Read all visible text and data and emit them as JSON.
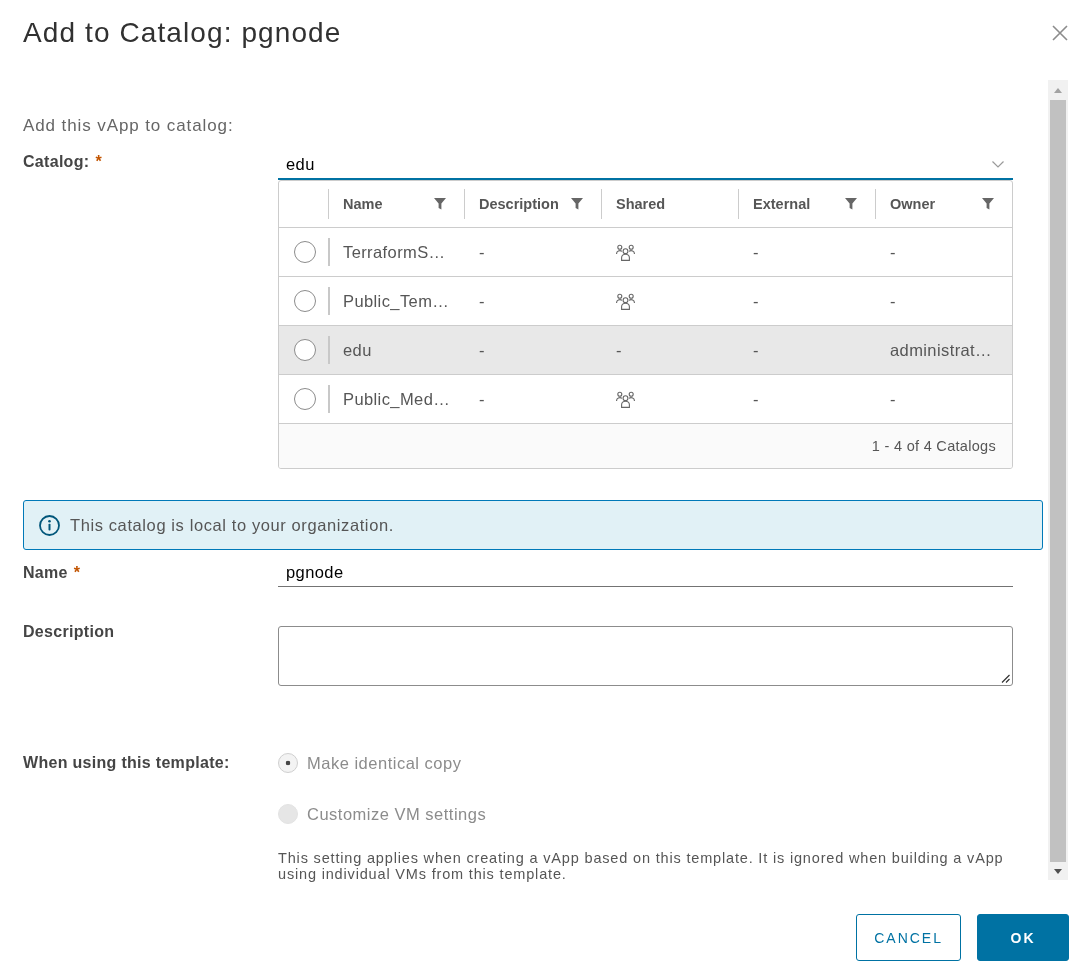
{
  "dialog": {
    "title": "Add to Catalog: pgnode"
  },
  "intro": "Add this vApp to catalog:",
  "catalog": {
    "label": "Catalog:",
    "required_mark": "*",
    "value": "edu",
    "table": {
      "columns": [
        {
          "label": "Name",
          "filter": true
        },
        {
          "label": "Description",
          "filter": true
        },
        {
          "label": "Shared",
          "filter": false
        },
        {
          "label": "External",
          "filter": true
        },
        {
          "label": "Owner",
          "filter": true
        }
      ],
      "rows": [
        {
          "selected": false,
          "highlighted": false,
          "cells": [
            {
              "kind": "text",
              "text": "TerraformS…"
            },
            {
              "kind": "text",
              "text": "-"
            },
            {
              "kind": "icon"
            },
            {
              "kind": "text",
              "text": "-"
            },
            {
              "kind": "text",
              "text": "-"
            }
          ]
        },
        {
          "selected": false,
          "highlighted": false,
          "cells": [
            {
              "kind": "text",
              "text": "Public_Tem…"
            },
            {
              "kind": "text",
              "text": "-"
            },
            {
              "kind": "icon"
            },
            {
              "kind": "text",
              "text": "-"
            },
            {
              "kind": "text",
              "text": "-"
            }
          ]
        },
        {
          "selected": false,
          "highlighted": true,
          "cells": [
            {
              "kind": "text",
              "text": "edu"
            },
            {
              "kind": "text",
              "text": "-"
            },
            {
              "kind": "text",
              "text": "-"
            },
            {
              "kind": "text",
              "text": "-"
            },
            {
              "kind": "text",
              "text": "administrat…"
            }
          ]
        },
        {
          "selected": false,
          "highlighted": false,
          "cells": [
            {
              "kind": "text",
              "text": "Public_Med…"
            },
            {
              "kind": "text",
              "text": "-"
            },
            {
              "kind": "icon"
            },
            {
              "kind": "text",
              "text": "-"
            },
            {
              "kind": "text",
              "text": "-"
            }
          ]
        }
      ],
      "footer": "1 - 4 of 4 Catalogs"
    }
  },
  "alert": {
    "kind": "info",
    "text": "This catalog is local to your organization."
  },
  "name_field": {
    "label": "Name",
    "required_mark": "*",
    "value": "pgnode"
  },
  "description_field": {
    "label": "Description"
  },
  "template_options": {
    "label": "When using this template:",
    "options": [
      {
        "label": "Make identical copy",
        "selected": true,
        "disabled": true
      },
      {
        "label": "Customize VM settings",
        "selected": false,
        "disabled": true
      }
    ],
    "help": "This setting applies when creating a vApp based on this template. It is ignored when building a vApp using individual VMs from this template."
  },
  "buttons": [
    {
      "label": "CANCEL",
      "kind": "outline"
    },
    {
      "label": "OK",
      "kind": "primary"
    }
  ]
}
